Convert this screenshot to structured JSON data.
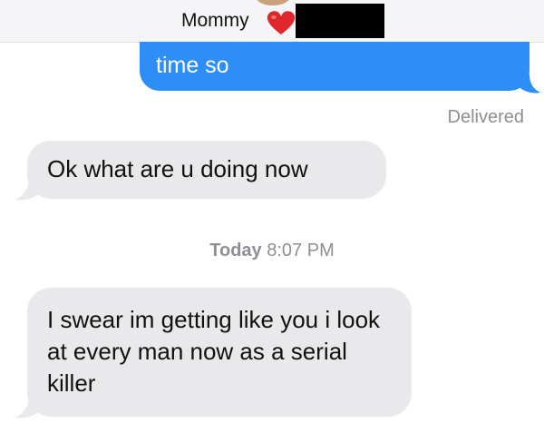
{
  "header": {
    "contact_name": "Mommy",
    "heart_emoji": "❤️",
    "heart_color": "#e0262d",
    "redacted_bar_color": "#000000"
  },
  "messages": {
    "outgoing_1": "time so",
    "delivered_status": "Delivered",
    "incoming_1": "Ok what are u doing now",
    "timestamp_day": "Today",
    "timestamp_time": "8:07 PM",
    "incoming_2": "I swear im getting like you i look at every man now as a serial killer"
  },
  "colors": {
    "outgoing_bubble": "#2e8ef8",
    "incoming_bubble": "#e9e9eb",
    "meta_text": "#8e8e93"
  }
}
